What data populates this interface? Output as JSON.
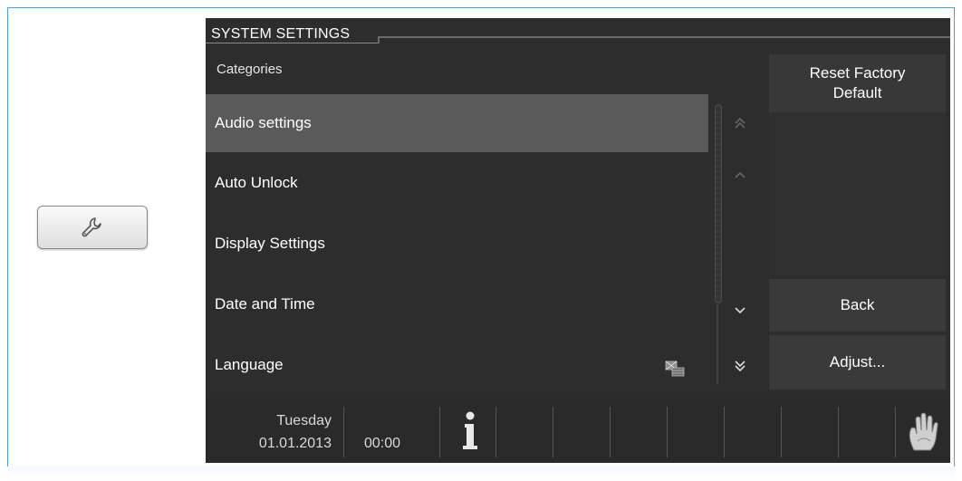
{
  "title": "SYSTEM SETTINGS",
  "categories_label": "Categories",
  "categories": [
    {
      "label": "Audio settings",
      "selected": true
    },
    {
      "label": "Auto Unlock",
      "selected": false
    },
    {
      "label": "Display Settings",
      "selected": false
    },
    {
      "label": "Date and Time",
      "selected": false
    },
    {
      "label": "Language",
      "selected": false
    }
  ],
  "buttons": {
    "reset_line1": "Reset Factory",
    "reset_line2": "Default",
    "back": "Back",
    "adjust": "Adjust..."
  },
  "status": {
    "day": "Tuesday",
    "date": "01.01.2013",
    "time": "00:00"
  },
  "icons": {
    "side_button": "wrench-icon",
    "language": "language-flags-icon",
    "info": "info-icon",
    "hand": "hand-icon",
    "scroll_top": "double-chevron-up-icon",
    "scroll_up": "chevron-up-icon",
    "scroll_down": "chevron-down-icon",
    "scroll_bottom": "double-chevron-down-icon"
  },
  "colors": {
    "screen_bg": "#2d2d2d",
    "selected_row": "#5a5a5a",
    "frame_border": "#4aa0d8"
  }
}
